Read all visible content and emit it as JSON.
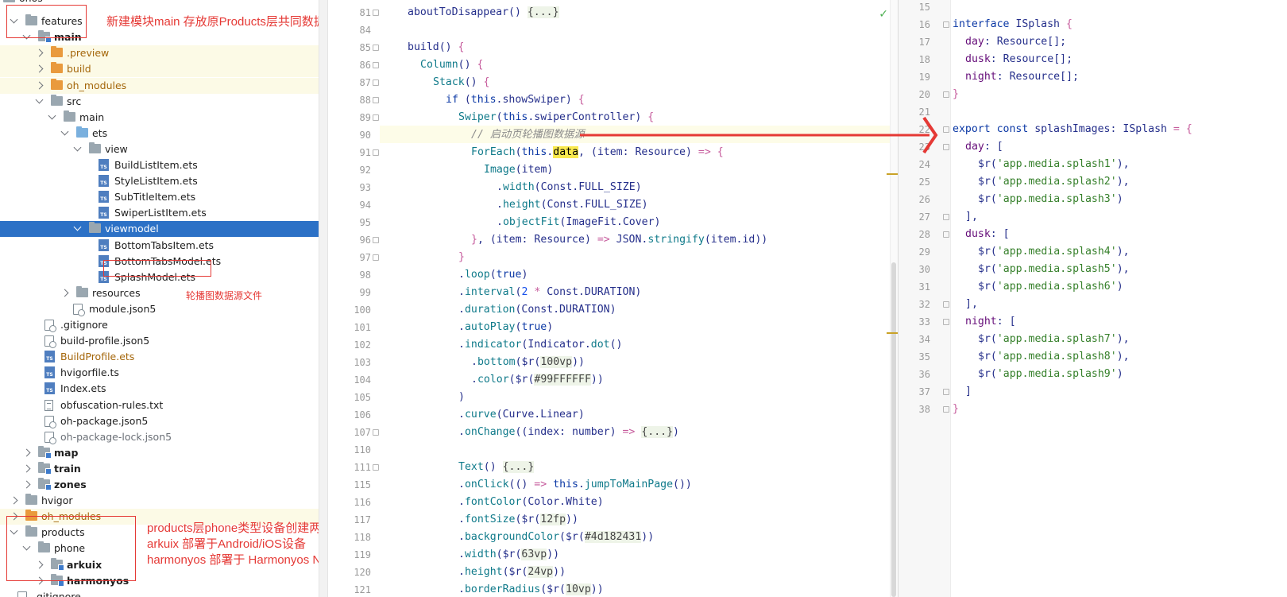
{
  "tree": {
    "rows": [
      {
        "label": "ohos",
        "indent": 4,
        "type": "folder",
        "expand": "",
        "style": ""
      },
      {
        "label": "features",
        "indent": 18,
        "type": "folder",
        "expand": "down",
        "style": ""
      },
      {
        "label": "main",
        "indent": 34,
        "type": "folder-mod",
        "expand": "down",
        "style": "bold"
      },
      {
        "label": ".preview",
        "indent": 50,
        "type": "folder-orange",
        "expand": "right",
        "style": "orange lib"
      },
      {
        "label": "build",
        "indent": 50,
        "type": "folder-orange",
        "expand": "right",
        "style": "orange lib"
      },
      {
        "label": "oh_modules",
        "indent": 50,
        "type": "folder-orange",
        "expand": "right",
        "style": "orange lib"
      },
      {
        "label": "src",
        "indent": 50,
        "type": "folder",
        "expand": "down",
        "style": ""
      },
      {
        "label": "main",
        "indent": 66,
        "type": "folder",
        "expand": "down",
        "style": ""
      },
      {
        "label": "ets",
        "indent": 82,
        "type": "folder-blue",
        "expand": "down",
        "style": ""
      },
      {
        "label": "view",
        "indent": 98,
        "type": "folder",
        "expand": "down",
        "style": ""
      },
      {
        "label": "BuildListItem.ets",
        "indent": 124,
        "type": "ts",
        "expand": "",
        "style": ""
      },
      {
        "label": "StyleListItem.ets",
        "indent": 124,
        "type": "ts",
        "expand": "",
        "style": ""
      },
      {
        "label": "SubTitleItem.ets",
        "indent": 124,
        "type": "ts",
        "expand": "",
        "style": ""
      },
      {
        "label": "SwiperListItem.ets",
        "indent": 124,
        "type": "ts",
        "expand": "",
        "style": ""
      },
      {
        "label": "viewmodel",
        "indent": 98,
        "type": "folder",
        "expand": "down",
        "style": "sel"
      },
      {
        "label": "BottomTabsItem.ets",
        "indent": 124,
        "type": "ts",
        "expand": "",
        "style": ""
      },
      {
        "label": "BottomTabsModel.ets",
        "indent": 124,
        "type": "ts",
        "expand": "",
        "style": ""
      },
      {
        "label": "SplashModel.ets",
        "indent": 124,
        "type": "ts",
        "expand": "",
        "style": ""
      },
      {
        "label": "resources",
        "indent": 82,
        "type": "folder",
        "expand": "right",
        "style": ""
      },
      {
        "label": "module.json5",
        "indent": 92,
        "type": "json",
        "expand": "",
        "style": ""
      },
      {
        "label": ".gitignore",
        "indent": 56,
        "type": "json",
        "expand": "",
        "style": ""
      },
      {
        "label": "build-profile.json5",
        "indent": 56,
        "type": "json",
        "expand": "",
        "style": ""
      },
      {
        "label": "BuildProfile.ets",
        "indent": 56,
        "type": "ts",
        "expand": "",
        "style": "orange"
      },
      {
        "label": "hvigorfile.ts",
        "indent": 56,
        "type": "ts",
        "expand": "",
        "style": ""
      },
      {
        "label": "Index.ets",
        "indent": 56,
        "type": "ts",
        "expand": "",
        "style": ""
      },
      {
        "label": "obfuscation-rules.txt",
        "indent": 56,
        "type": "txt",
        "expand": "",
        "style": ""
      },
      {
        "label": "oh-package.json5",
        "indent": 56,
        "type": "json",
        "expand": "",
        "style": ""
      },
      {
        "label": "oh-package-lock.json5",
        "indent": 56,
        "type": "json",
        "expand": "",
        "style": "muted"
      },
      {
        "label": "map",
        "indent": 34,
        "type": "folder-mod",
        "expand": "right",
        "style": "bold"
      },
      {
        "label": "train",
        "indent": 34,
        "type": "folder-mod",
        "expand": "right",
        "style": "bold"
      },
      {
        "label": "zones",
        "indent": 34,
        "type": "folder-mod",
        "expand": "right",
        "style": "bold"
      },
      {
        "label": "hvigor",
        "indent": 18,
        "type": "folder",
        "expand": "right",
        "style": ""
      },
      {
        "label": "oh_modules",
        "indent": 18,
        "type": "folder-orange",
        "expand": "right",
        "style": "orange lib"
      },
      {
        "label": "products",
        "indent": 18,
        "type": "folder",
        "expand": "down",
        "style": ""
      },
      {
        "label": "phone",
        "indent": 34,
        "type": "folder",
        "expand": "down",
        "style": ""
      },
      {
        "label": "arkuix",
        "indent": 50,
        "type": "folder-mod",
        "expand": "right",
        "style": "bold"
      },
      {
        "label": "harmonyos",
        "indent": 50,
        "type": "folder-mod",
        "expand": "right",
        "style": "bold"
      },
      {
        "label": ".gitignore",
        "indent": 22,
        "type": "json",
        "expand": "",
        "style": ""
      }
    ]
  },
  "annotations": {
    "main_note": "新建模块main 存放原Products层共同数据",
    "splash_note": "轮播图数据源文件",
    "products_note": [
      "products层phone类型设备创建两个module",
      "arkuix 部署于Android/iOS设备",
      "harmonyos 部署于 Harmonyos Next设备"
    ]
  },
  "editor_left": {
    "lines": [
      {
        "n": "81",
        "indent": 1,
        "html": "aboutToDisappear() <span class='fc'>{...}</span>",
        "fold": true
      },
      {
        "n": "84",
        "indent": 0,
        "html": "",
        "fold": false
      },
      {
        "n": "85",
        "indent": 1,
        "html": "build() <span class='br'>{</span>",
        "fold": true
      },
      {
        "n": "86",
        "indent": 2,
        "html": "<span class='fn'>Column</span>() <span class='br'>{</span>",
        "fold": true
      },
      {
        "n": "87",
        "indent": 3,
        "html": "<span class='fn'>Stack</span>() <span class='br'>{</span>",
        "fold": true
      },
      {
        "n": "88",
        "indent": 4,
        "html": "<span class='kw'>if</span> (<span class='kw'>this</span>.showSwiper) <span class='br'>{</span>",
        "fold": true
      },
      {
        "n": "89",
        "indent": 5,
        "html": "<span class='fn'>Swiper</span>(<span class='kw'>this</span>.swiperController) <span class='br'>{</span>",
        "fold": true
      },
      {
        "n": "90",
        "indent": 6,
        "html": "<span class='cm'>// 启动页轮播图数据源</span>",
        "fold": false
      },
      {
        "n": "91",
        "indent": 6,
        "html": "<span class='fn'>ForEach</span>(<span class='kw'>this</span>.<span class='hl'>data</span>, (item: <span class='cls'>Resource</span>) <span class='op'>=&gt;</span> <span class='br'>{</span>",
        "fold": true
      },
      {
        "n": "92",
        "indent": 7,
        "html": "<span class='fn'>Image</span>(item)",
        "fold": false
      },
      {
        "n": "93",
        "indent": 8,
        "html": ".<span class='fn'>width</span>(Const.FULL_SIZE)",
        "fold": false
      },
      {
        "n": "94",
        "indent": 8,
        "html": ".<span class='fn'>height</span>(Const.FULL_SIZE)",
        "fold": false
      },
      {
        "n": "95",
        "indent": 8,
        "html": ".<span class='fn'>objectFit</span>(ImageFit.Cover)",
        "fold": false
      },
      {
        "n": "96",
        "indent": 6,
        "html": "<span class='br'>}</span>, (item: <span class='cls'>Resource</span>) <span class='op'>=&gt;</span> JSON.<span class='fn'>stringify</span>(item.id))",
        "fold": true
      },
      {
        "n": "97",
        "indent": 5,
        "html": "<span class='br'>}</span>",
        "fold": true
      },
      {
        "n": "98",
        "indent": 5,
        "html": ".<span class='fn'>loop</span>(<span class='kw'>true</span>)",
        "fold": false
      },
      {
        "n": "99",
        "indent": 5,
        "html": ".<span class='fn'>interval</span>(<span class='num'>2</span> <span class='op'>*</span> Const.DURATION)",
        "fold": false
      },
      {
        "n": "100",
        "indent": 5,
        "html": ".<span class='fn'>duration</span>(Const.DURATION)",
        "fold": false
      },
      {
        "n": "101",
        "indent": 5,
        "html": ".<span class='fn'>autoPlay</span>(<span class='kw'>true</span>)",
        "fold": false
      },
      {
        "n": "102",
        "indent": 5,
        "html": ".<span class='fn'>indicator</span>(Indicator.<span class='fn'>dot</span>()",
        "fold": false
      },
      {
        "n": "103",
        "indent": 6,
        "html": ".<span class='fn'>bottom</span>($r(<span class='fc'>100vp</span>))",
        "fold": false
      },
      {
        "n": "104",
        "indent": 6,
        "html": ".<span class='fn'>color</span>($r(<span class='fc'>#99FFFFFF</span>))",
        "fold": false
      },
      {
        "n": "105",
        "indent": 5,
        "html": ")",
        "fold": false
      },
      {
        "n": "106",
        "indent": 5,
        "html": ".<span class='fn'>curve</span>(Curve.Linear)",
        "fold": false
      },
      {
        "n": "107",
        "indent": 5,
        "html": ".<span class='fn'>onChange</span>((index: <span class='cls'>number</span>) <span class='op'>=&gt;</span> <span class='fc'>{...}</span>)",
        "fold": true
      },
      {
        "n": "110",
        "indent": 0,
        "html": "",
        "fold": false
      },
      {
        "n": "111",
        "indent": 5,
        "html": "<span class='fn'>Text</span>() <span class='fc'>{...}</span>",
        "fold": true
      },
      {
        "n": "115",
        "indent": 5,
        "html": ".<span class='fn'>onClick</span>(() <span class='op'>=&gt;</span> <span class='kw'>this</span>.<span class='fn'>jumpToMainPage</span>())",
        "fold": false
      },
      {
        "n": "116",
        "indent": 5,
        "html": ".<span class='fn'>fontColor</span>(Color.White)",
        "fold": false
      },
      {
        "n": "117",
        "indent": 5,
        "html": ".<span class='fn'>fontSize</span>($r(<span class='fc'>12fp</span>))",
        "fold": false
      },
      {
        "n": "118",
        "indent": 5,
        "html": ".<span class='fn'>backgroundColor</span>($r(<span class='fc'>#4d182431</span>))",
        "fold": false
      },
      {
        "n": "119",
        "indent": 5,
        "html": ".<span class='fn'>width</span>($r(<span class='fc'>63vp</span>))",
        "fold": false
      },
      {
        "n": "120",
        "indent": 5,
        "html": ".<span class='fn'>height</span>($r(<span class='fc'>24vp</span>))",
        "fold": false
      },
      {
        "n": "121",
        "indent": 5,
        "html": ".<span class='fn'>borderRadius</span>($r(<span class='fc'>10vp</span>))",
        "fold": false
      }
    ]
  },
  "editor_right": {
    "lines": [
      {
        "n": "15",
        "indent": 0,
        "html": "",
        "fold": false
      },
      {
        "n": "16",
        "indent": 0,
        "html": "<span class='kw'>interface</span> ISplash <span class='br'>{</span>",
        "fold": true
      },
      {
        "n": "17",
        "indent": 1,
        "html": "<span class='pr'>day</span>: <span class='cls'>Resource</span>[];",
        "fold": false
      },
      {
        "n": "18",
        "indent": 1,
        "html": "<span class='pr'>dusk</span>: <span class='cls'>Resource</span>[];",
        "fold": false
      },
      {
        "n": "19",
        "indent": 1,
        "html": "<span class='pr'>night</span>: <span class='cls'>Resource</span>[];",
        "fold": false
      },
      {
        "n": "20",
        "indent": 0,
        "html": "<span class='br'>}</span>",
        "fold": true
      },
      {
        "n": "21",
        "indent": 0,
        "html": "",
        "fold": false
      },
      {
        "n": "22",
        "indent": 0,
        "html": "<span class='kw'>export const</span> splashImages: ISplash <span class='op'>=</span> <span class='br'>{</span>",
        "fold": true
      },
      {
        "n": "23",
        "indent": 1,
        "html": "<span class='pr'>day</span>: [",
        "fold": true
      },
      {
        "n": "24",
        "indent": 2,
        "html": "$r(<span class='str'>'app.media.splash1'</span>),",
        "fold": false
      },
      {
        "n": "25",
        "indent": 2,
        "html": "$r(<span class='str'>'app.media.splash2'</span>),",
        "fold": false
      },
      {
        "n": "26",
        "indent": 2,
        "html": "$r(<span class='str'>'app.media.splash3'</span>)",
        "fold": false
      },
      {
        "n": "27",
        "indent": 1,
        "html": "],",
        "fold": true
      },
      {
        "n": "28",
        "indent": 1,
        "html": "<span class='pr'>dusk</span>: [",
        "fold": true
      },
      {
        "n": "29",
        "indent": 2,
        "html": "$r(<span class='str'>'app.media.splash4'</span>),",
        "fold": false
      },
      {
        "n": "30",
        "indent": 2,
        "html": "$r(<span class='str'>'app.media.splash5'</span>),",
        "fold": false
      },
      {
        "n": "31",
        "indent": 2,
        "html": "$r(<span class='str'>'app.media.splash6'</span>)",
        "fold": false
      },
      {
        "n": "32",
        "indent": 1,
        "html": "],",
        "fold": true
      },
      {
        "n": "33",
        "indent": 1,
        "html": "<span class='pr'>night</span>: [",
        "fold": true
      },
      {
        "n": "34",
        "indent": 2,
        "html": "$r(<span class='str'>'app.media.splash7'</span>),",
        "fold": false
      },
      {
        "n": "35",
        "indent": 2,
        "html": "$r(<span class='str'>'app.media.splash8'</span>),",
        "fold": false
      },
      {
        "n": "36",
        "indent": 2,
        "html": "$r(<span class='str'>'app.media.splash9'</span>)",
        "fold": false
      },
      {
        "n": "37",
        "indent": 1,
        "html": "]",
        "fold": true
      },
      {
        "n": "38",
        "indent": 0,
        "html": "<span class='br'>}</span>",
        "fold": true
      }
    ]
  },
  "colors": {
    "annotation_red": "#e53935",
    "selection_blue": "#2c71c6",
    "inspection_ok_green": "#4caf50"
  }
}
